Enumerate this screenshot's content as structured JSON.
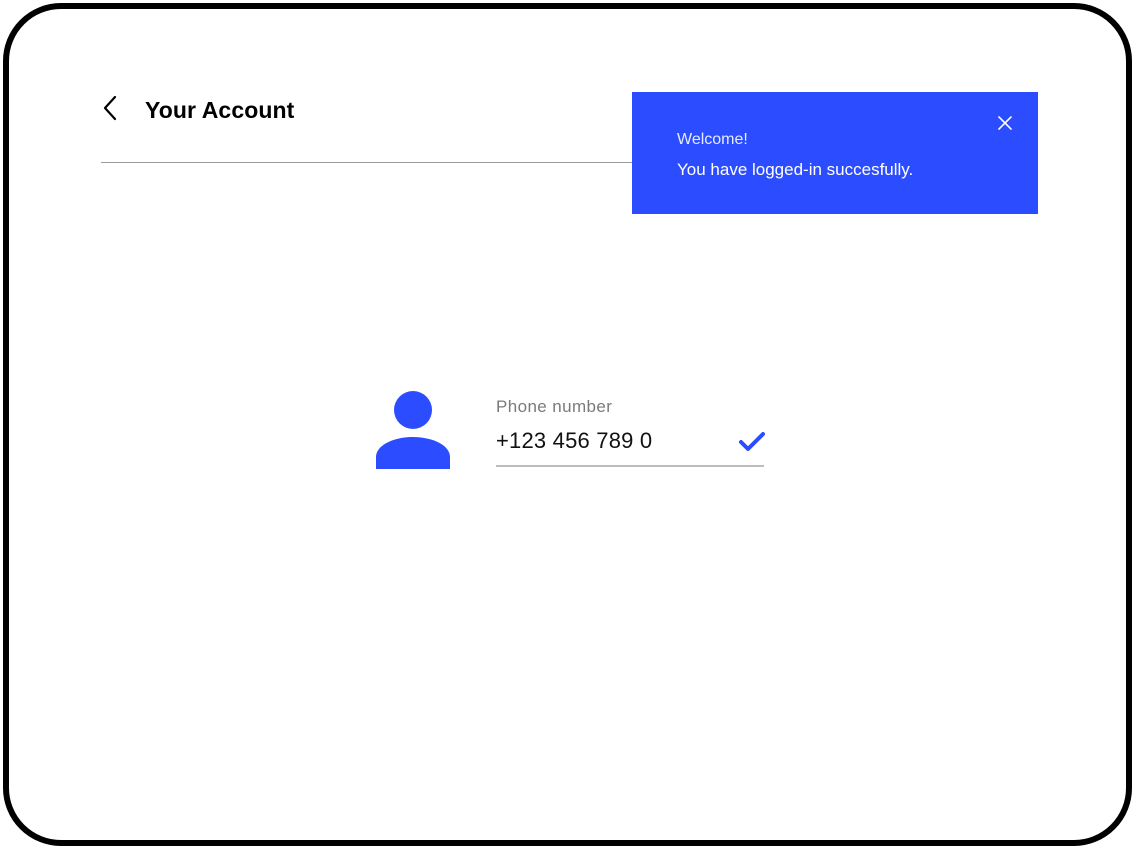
{
  "header": {
    "title": "Your Account",
    "back_icon": "chevron-left-icon"
  },
  "toast": {
    "title": "Welcome!",
    "message": "You have logged-in succesfully.",
    "close_icon": "close-icon",
    "background": "#2b4dff"
  },
  "profile": {
    "avatar_icon": "user-icon",
    "phone_label": "Phone number",
    "phone_value": "+123 456 789 0",
    "verified_icon": "check-icon",
    "accent": "#2b4dff"
  }
}
